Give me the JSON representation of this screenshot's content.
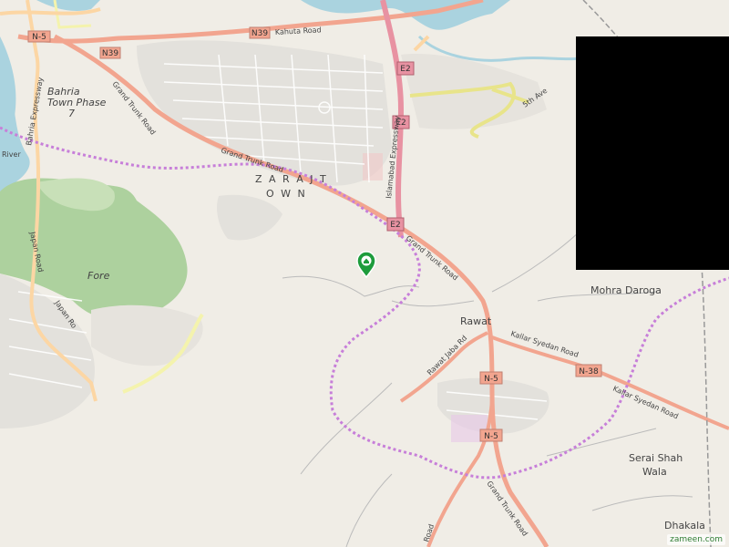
{
  "map": {
    "labels": {
      "n5_top": "N-5",
      "n39_left": "N39",
      "n39_top": "N39",
      "kahuta_road": "Kahuta Road",
      "e2_top": "E2",
      "e2_mid": "E2",
      "e2_bottom": "E2",
      "fifth_ave": "5th Ave",
      "bahria_town": "Bahria Town Phase 7",
      "bahria_town_line1": "Bahria",
      "bahria_town_line2": "Town Phase",
      "bahria_town_line3": "7",
      "bahria_expressway": "Bahria Expressway",
      "river": "River",
      "grand_trunk_road_left": "Grand Trunk Road",
      "grand_trunk_road_mid": "Grand Trunk Road",
      "grand_trunk_road_right": "Grand Trunk Road",
      "grand_trunk_road_bottom": "Grand Trunk Road",
      "islamabad_expressway": "Islamabad Expressway",
      "zarait_line1": "Z A R A J T",
      "zarait_line2": "O W N",
      "japan_road_top": "Japan Road",
      "japan_road_mid": "Japan Ro",
      "forest": "Fore",
      "mohra_daroga": "Mohra Daroga",
      "rawat": "Rawat",
      "rawat_jaba_rd": "Rawat Jaba Rd",
      "kallar_syedan_road_1": "Kallar Syedan Road",
      "kallar_syedan_road_2": "Kallar Syedan Road",
      "n38": "N-38",
      "n5_mid": "N-5",
      "n5_bottom": "N-5",
      "serai_line1": "Serai Shah",
      "serai_line2": "Wala",
      "dhakala": "Dhakala",
      "road_bottom": "Road"
    },
    "pin": {
      "color": "#1e9c3c",
      "icon": "home-icon"
    },
    "brand": "zameen.com",
    "colors": {
      "land": "#f0ede6",
      "water": "#aad3df",
      "forest": "#add19e",
      "trunk": "#f2a58f",
      "motorway": "#e892a2",
      "primary": "#fcd6a4",
      "secondary": "#f7fabf",
      "boundary": "#c77fd9",
      "urban": "#e0dfdf"
    }
  }
}
